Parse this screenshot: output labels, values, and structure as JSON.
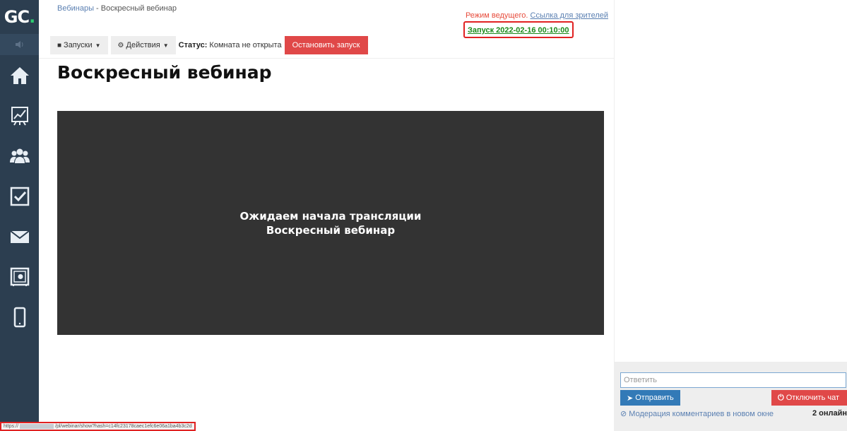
{
  "logo": {
    "text_main": "GC",
    "text_dot": "."
  },
  "sidebar": {
    "items": [
      {
        "name": "home"
      },
      {
        "name": "chart"
      },
      {
        "name": "users"
      },
      {
        "name": "tasks"
      },
      {
        "name": "mail"
      },
      {
        "name": "safe"
      },
      {
        "name": "mobile"
      }
    ]
  },
  "breadcrumb": {
    "parent": "Вебинары",
    "separator": " - ",
    "current": "Воскресный вебинар"
  },
  "header": {
    "mode_text": "Режим ведущего.",
    "viewer_link": "Ссылка для зрителей",
    "launch_link": "Запуск 2022-02-16 00:10:00"
  },
  "toolbar": {
    "launches_label": "Запуски",
    "actions_label": "Действия",
    "status_label": "Статус:",
    "status_value": "Комната не открыта",
    "stop_label": "Остановить запуск"
  },
  "page": {
    "title": "Воскресный вебинар"
  },
  "video": {
    "waiting_text": "Ожидаем начала трансляции",
    "webinar_name": "Воскресный вебинар"
  },
  "chat": {
    "reply_placeholder": "Ответить",
    "send_label": "Отправить",
    "disable_label": "Отключить чат",
    "moderation_label": "Модерация комментариев в новом окне",
    "online_count": "2 онлайн"
  },
  "statusbar": {
    "url_prefix": "https://",
    "url_rest": "/pl/webinar/show?hash=c14fc23178caec1efc6e06a1ba4b3c2d"
  },
  "colors": {
    "sidebar": "#2c3e50",
    "accent_red": "#e04848",
    "accent_blue": "#337ab7",
    "link": "#5b80b2",
    "launch_green": "#1a8a1a"
  }
}
